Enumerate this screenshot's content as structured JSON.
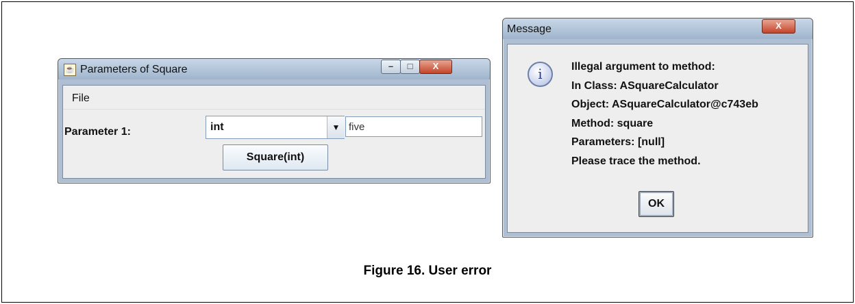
{
  "param_window": {
    "title": "Parameters of Square",
    "controls": {
      "minimize": "–",
      "maximize": "□",
      "close": "X"
    },
    "menu": {
      "file": "File"
    },
    "param_label": "Parameter 1:",
    "type_combo": {
      "value": "int",
      "arrow": "▼"
    },
    "value_field": "five",
    "action_button": "Square(int)"
  },
  "message_window": {
    "title": "Message",
    "close": "X",
    "icon_glyph": "i",
    "lines": [
      "Illegal argument to method:",
      "In Class: ASquareCalculator",
      "Object: ASquareCalculator@c743eb",
      "Method: square",
      "Parameters: [null]",
      "Please trace the method."
    ],
    "ok_button": "OK"
  },
  "caption": "Figure 16. User error"
}
